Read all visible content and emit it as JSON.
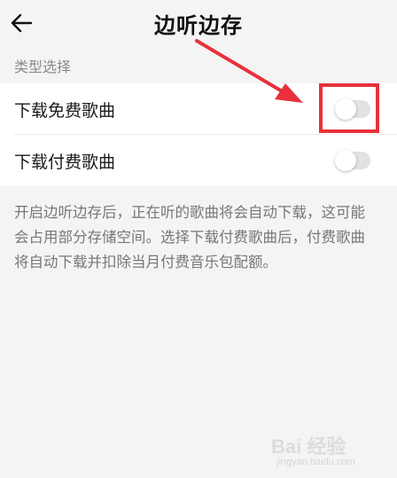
{
  "header": {
    "back_icon": "arrow-left-icon",
    "title": "边听边存"
  },
  "section": {
    "label": "类型选择"
  },
  "settings": [
    {
      "label": "下载免费歌曲",
      "enabled": false
    },
    {
      "label": "下载付费歌曲",
      "enabled": false
    }
  ],
  "description": {
    "text": "开启边听边存后，正在听的歌曲将会自动下载，这可能会占用部分存储空间。选择下载付费歌曲后，付费歌曲将自动下载并扣除当月付费音乐包配额。"
  },
  "annotation": {
    "color": "#e8313a"
  },
  "watermark": {
    "brand": "Bai 经验",
    "url": "jingyan.baidu.com"
  }
}
